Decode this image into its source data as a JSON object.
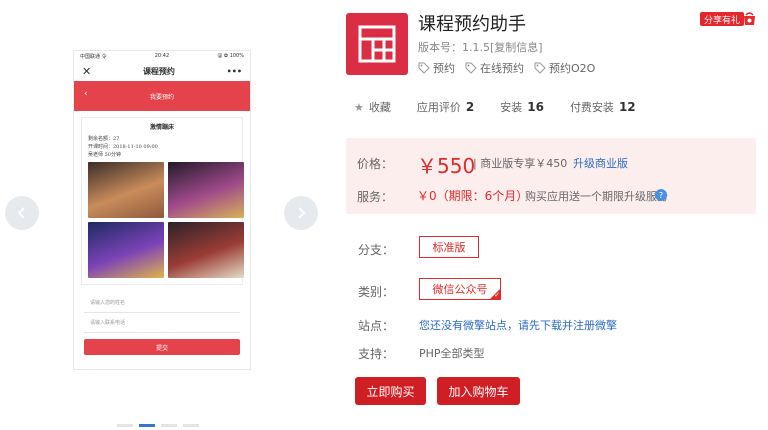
{
  "gallery": {
    "phone": {
      "status_carrier": "中国联通 令",
      "status_time": "20:42",
      "status_battery": "@ ✿ 100%",
      "close": "✕",
      "title": "课程预约",
      "more": "•••",
      "banner_back": "‹",
      "banner_title": "我要预约",
      "card_title": "激情蹦床",
      "card_rows": [
        "剩余名额：27",
        "开课时间：2018-11-10 09:00",
        "吴老师 50分钟"
      ],
      "input1_placeholder": "请输入您的姓名",
      "input2_placeholder": "请输入联系电话",
      "submit": "提交"
    },
    "images": [
      {
        "colors": [
          "#3a2d2a",
          "#c98c5a",
          "#8e5a3d"
        ]
      },
      {
        "colors": [
          "#231a2c",
          "#a04a8a",
          "#d7b25a"
        ]
      },
      {
        "colors": [
          "#1d2a63",
          "#7c43b7",
          "#e0b44a"
        ]
      },
      {
        "colors": [
          "#2b2229",
          "#9b3c35",
          "#e6dcc8"
        ]
      }
    ],
    "active_dot": 1,
    "dot_count": 4
  },
  "product": {
    "name": "课程预约助手",
    "version": "版本号：1.1.5[复制信息]",
    "tags": [
      "预约",
      "在线预约",
      "预约O2O"
    ],
    "share": "分享有礼",
    "stats": {
      "collect": "收藏",
      "review_label": "应用评价",
      "review_count": "2",
      "install_label": "安装",
      "install_count": "16",
      "paid_label": "付费安装",
      "paid_count": "12"
    },
    "price": {
      "label": "价格：",
      "value": "￥550",
      "commercial": "| 商业版专享￥450",
      "upgrade": "升级商业版"
    },
    "service": {
      "label": "服务：",
      "value": "￥0（期限：6个月）",
      "note": "购买应用送一个期限升级服务",
      "help": "?"
    },
    "branch": {
      "label": "分支：",
      "option": "标准版"
    },
    "category": {
      "label": "类别：",
      "option": "微信公众号",
      "check": "✓"
    },
    "site": {
      "label": "站点：",
      "text": "您还没有微擎站点，请先下载并注册微擎"
    },
    "support": {
      "label": "支持：",
      "value": "PHP全部类型"
    },
    "buy_now": "立即购买",
    "add_cart": "加入购物车"
  },
  "colors": {
    "brand_red": "#db2e45",
    "price_red": "#e12b2b",
    "button_red": "#cf1e24",
    "link_blue": "#2b6cc4",
    "price_bg": "#fdeeee"
  }
}
